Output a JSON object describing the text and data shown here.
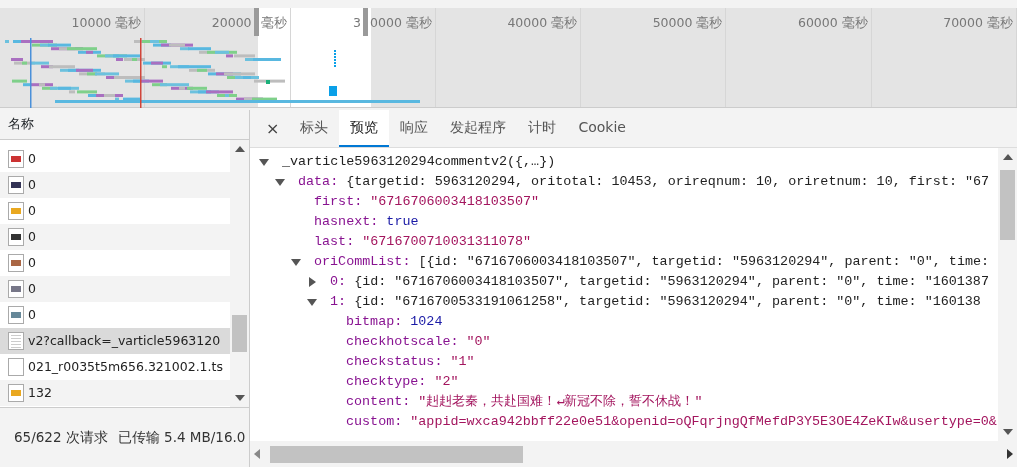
{
  "timeline": {
    "ticks": [
      [
        "10000 毫秒"
      ],
      [
        "20000",
        "毫秒"
      ],
      [
        "3",
        "0000 毫秒"
      ],
      [
        "40000 毫秒"
      ],
      [
        "50000 毫秒"
      ],
      [
        "60000 毫秒"
      ],
      [
        "70000 毫秒"
      ]
    ]
  },
  "requests": {
    "header": "名称",
    "rows": [
      {
        "name": "0",
        "kind": "image",
        "selected": false
      },
      {
        "name": "0",
        "kind": "image",
        "selected": false
      },
      {
        "name": "0",
        "kind": "image",
        "selected": false
      },
      {
        "name": "0",
        "kind": "image",
        "selected": false
      },
      {
        "name": "0",
        "kind": "image",
        "selected": false
      },
      {
        "name": "0",
        "kind": "image",
        "selected": false
      },
      {
        "name": "0",
        "kind": "image",
        "selected": false
      },
      {
        "name": "v2?callback=_varticle5963120",
        "kind": "document",
        "selected": true
      },
      {
        "name": "021_r0035t5m656.321002.1.ts",
        "kind": "blank",
        "selected": false
      },
      {
        "name": "132",
        "kind": "image",
        "selected": false
      }
    ],
    "status": [
      "65/622 次请求",
      "已传输 5.4 MB/16.0"
    ]
  },
  "detail": {
    "close": "×",
    "tabs": [
      {
        "label": "标头",
        "selected": false
      },
      {
        "label": "预览",
        "selected": true
      },
      {
        "label": "响应",
        "selected": false
      },
      {
        "label": "发起程序",
        "selected": false
      },
      {
        "label": "计时",
        "selected": false
      },
      {
        "label": "Cookie",
        "selected": false
      }
    ],
    "tree": [
      {
        "key": "_varticle5963120294commentv2({,…})",
        "expanded": true,
        "children": [
          {
            "key": "data:",
            "value": "{targetid: 5963120294, oritotal: 10453, orireqnum: 10, oriretnum: 10, first: \"67",
            "kind": "object",
            "expanded": true,
            "children": [
              {
                "key": "first:",
                "value": "\"6716706003418103507\"",
                "kind": "string"
              },
              {
                "key": "hasnext:",
                "value": "true",
                "kind": "boolean"
              },
              {
                "key": "last:",
                "value": "\"6716700710031311078\"",
                "kind": "string"
              },
              {
                "key": "oriCommList:",
                "value": "[{id: \"6716706003418103507\", targetid: \"5963120294\", parent: \"0\", time:",
                "kind": "object",
                "expanded": true,
                "children": [
                  {
                    "key": "0:",
                    "value": "{id: \"6716706003418103507\", targetid: \"5963120294\", parent: \"0\", time: \"1601387",
                    "kind": "object",
                    "expanded": false
                  },
                  {
                    "key": "1:",
                    "value": "{id: \"6716700533191061258\", targetid: \"5963120294\", parent: \"0\", time: \"160138",
                    "kind": "object",
                    "expanded": true,
                    "children": [
                      {
                        "key": "bitmap:",
                        "value": "1024",
                        "kind": "number"
                      },
                      {
                        "key": "checkhotscale:",
                        "value": "\"0\"",
                        "kind": "string"
                      },
                      {
                        "key": "checkstatus:",
                        "value": "\"1\"",
                        "kind": "string"
                      },
                      {
                        "key": "checktype:",
                        "value": "\"2\"",
                        "kind": "string"
                      },
                      {
                        "key": "content:",
                        "value": "\"赳赳老秦，共赴国难！↵新冠不除，誓不休战！\"",
                        "kind": "string"
                      },
                      {
                        "key": "custom:",
                        "value": "\"appid=wxca942bbff22e0e51&openid=oQFqrjngQfMefdP3Y5E3OE4ZeKIw&usertype=0&",
                        "kind": "string"
                      }
                    ]
                  }
                ]
              }
            ]
          }
        ]
      }
    ]
  }
}
